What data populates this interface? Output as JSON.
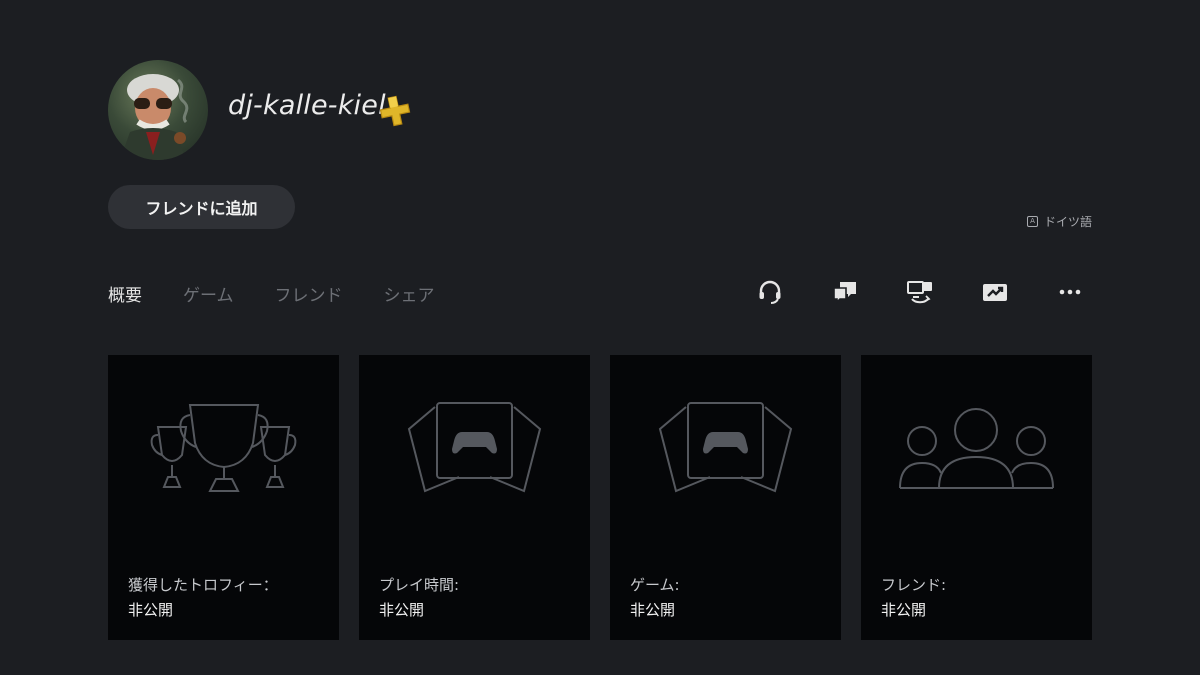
{
  "profile": {
    "username": "dj-kalle-kiel",
    "plus_badge": "playstation-plus-icon"
  },
  "buttons": {
    "add_friend": "フレンドに追加"
  },
  "language": {
    "label": "ドイツ語",
    "icon_text": "A"
  },
  "tabs": [
    {
      "label": "概要",
      "active": true
    },
    {
      "label": "ゲーム",
      "active": false
    },
    {
      "label": "フレンド",
      "active": false
    },
    {
      "label": "シェア",
      "active": false
    }
  ],
  "actions": [
    {
      "icon": "headset-icon"
    },
    {
      "icon": "messages-icon"
    },
    {
      "icon": "remote-play-icon"
    },
    {
      "icon": "share-screen-icon"
    },
    {
      "icon": "more-icon"
    }
  ],
  "cards": [
    {
      "icon": "trophy-icon",
      "label": "獲得したトロフィー：",
      "value": "非公開"
    },
    {
      "icon": "game-library-icon",
      "label": "プレイ時間:",
      "value": "非公開"
    },
    {
      "icon": "game-library-icon",
      "label": "ゲーム:",
      "value": "非公開"
    },
    {
      "icon": "friends-icon",
      "label": "フレンド:",
      "value": "非公開"
    }
  ],
  "colors": {
    "background": "#1c1e22",
    "card": "#050608",
    "button": "#2f3136",
    "plus_gold": "#e0b629",
    "muted_tab": "#6d7076"
  }
}
